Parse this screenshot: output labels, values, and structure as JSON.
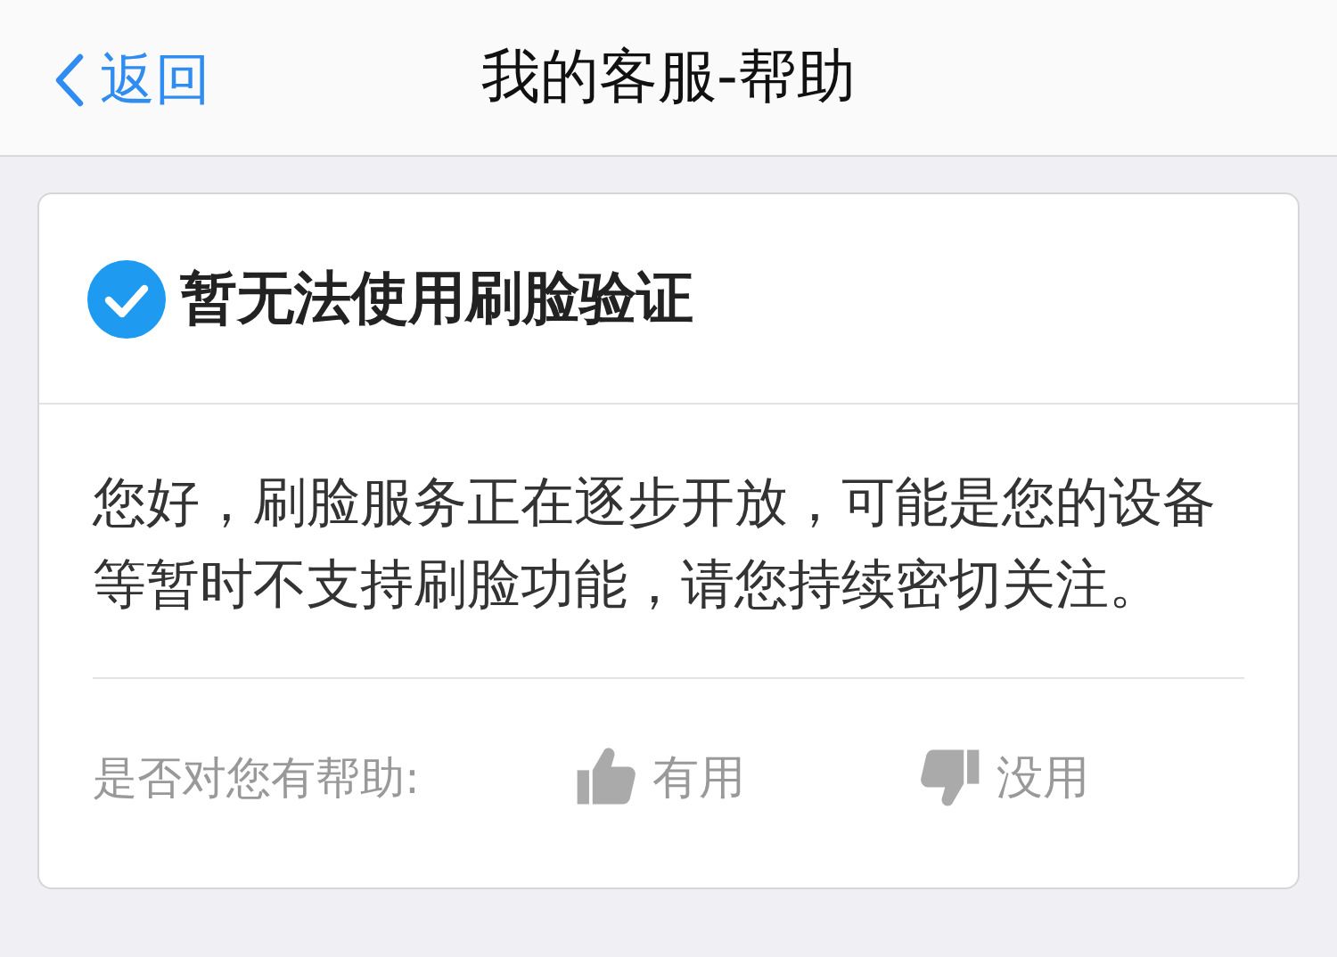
{
  "nav_bar": {
    "back_label": "返回",
    "title": "我的客服-帮助"
  },
  "card": {
    "title": "暂无法使用刷脸验证",
    "body": "您好，刷脸服务正在逐步开放，可能是您的设备等暂时不支持刷脸功能，请您持续密切关注。",
    "feedback": {
      "prompt": "是否对您有帮助:",
      "options": [
        {
          "kind": "up",
          "label": "有用"
        },
        {
          "kind": "down",
          "label": "没用"
        }
      ]
    }
  }
}
